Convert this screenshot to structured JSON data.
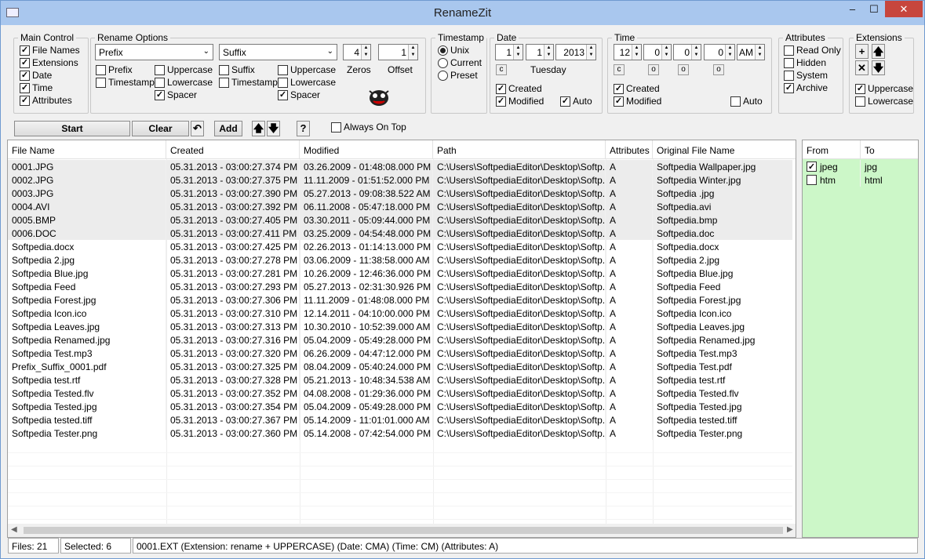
{
  "window": {
    "title": "RenameZit",
    "min": "–",
    "max": "☐",
    "close": "✕"
  },
  "main_control": {
    "legend": "Main Control",
    "items": [
      {
        "label": "File Names",
        "checked": true
      },
      {
        "label": "Extensions",
        "checked": true
      },
      {
        "label": "Date",
        "checked": true
      },
      {
        "label": "Time",
        "checked": true
      },
      {
        "label": "Attributes",
        "checked": true
      }
    ]
  },
  "rename_options": {
    "legend": "Rename Options",
    "prefix_value": "Prefix",
    "suffix_value": "Suffix",
    "zeros_value": "4",
    "offset_value": "1",
    "zeros_label": "Zeros",
    "offset_label": "Offset",
    "left_checks": [
      {
        "label": "Prefix",
        "checked": false
      },
      {
        "label": "Timestamp",
        "checked": false
      }
    ],
    "left_case": [
      {
        "label": "Uppercase",
        "checked": false
      },
      {
        "label": "Lowercase",
        "checked": false
      },
      {
        "label": "Spacer",
        "checked": true
      }
    ],
    "right_checks": [
      {
        "label": "Suffix",
        "checked": false
      },
      {
        "label": "Timestamp",
        "checked": false
      }
    ],
    "right_case": [
      {
        "label": "Uppercase",
        "checked": false
      },
      {
        "label": "Lowercase",
        "checked": false
      },
      {
        "label": "Spacer",
        "checked": true
      }
    ]
  },
  "timestamp": {
    "legend": "Timestamp",
    "options": [
      {
        "label": "Unix",
        "selected": true
      },
      {
        "label": "Current",
        "selected": false
      },
      {
        "label": "Preset",
        "selected": false
      }
    ]
  },
  "date": {
    "legend": "Date",
    "month": "1",
    "day": "1",
    "year": "2013",
    "c_label": "c",
    "weekday": "Tuesday",
    "created": {
      "label": "Created",
      "checked": true
    },
    "modified": {
      "label": "Modified",
      "checked": true
    },
    "auto": {
      "label": "Auto",
      "checked": true
    }
  },
  "time": {
    "legend": "Time",
    "hour": "12",
    "minute": "0",
    "second": "0",
    "ms": "0",
    "ampm": "AM",
    "c_label": "c",
    "o_label": "o",
    "created": {
      "label": "Created",
      "checked": true
    },
    "modified": {
      "label": "Modified",
      "checked": true
    },
    "auto": {
      "label": "Auto",
      "checked": false
    }
  },
  "attributes": {
    "legend": "Attributes",
    "items": [
      {
        "label": "Read Only",
        "checked": false
      },
      {
        "label": "Hidden",
        "checked": false
      },
      {
        "label": "System",
        "checked": false
      },
      {
        "label": "Archive",
        "checked": true
      }
    ]
  },
  "extensions": {
    "legend": "Extensions",
    "add": "+",
    "up": "🡅",
    "remove": "✕",
    "down": "🡇",
    "uppercase": {
      "label": "Uppercase",
      "checked": true
    },
    "lowercase": {
      "label": "Lowercase",
      "checked": false
    }
  },
  "toolbar": {
    "start": "Start",
    "clear": "Clear",
    "undo": "↶",
    "add": "Add",
    "up": "🡅",
    "down": "🡇",
    "help": "?",
    "always_on_top": {
      "label": "Always On Top",
      "checked": false
    }
  },
  "file_table": {
    "columns": [
      "File Name",
      "Created",
      "Modified",
      "Path",
      "Attributes",
      "Original File Name"
    ],
    "rows": [
      [
        "0001.JPG",
        "05.31.2013 - 03:00:27.374 PM",
        "03.26.2009 - 01:48:08.000 PM",
        "C:\\Users\\SoftpediaEditor\\Desktop\\Softp...",
        "A",
        "Softpedia Wallpaper.jpg"
      ],
      [
        "0002.JPG",
        "05.31.2013 - 03:00:27.375 PM",
        "11.11.2009 - 01:51:52.000 PM",
        "C:\\Users\\SoftpediaEditor\\Desktop\\Softp...",
        "A",
        "Softpedia Winter.jpg"
      ],
      [
        "0003.JPG",
        "05.31.2013 - 03:00:27.390 PM",
        "05.27.2013 - 09:08:38.522 AM",
        "C:\\Users\\SoftpediaEditor\\Desktop\\Softp...",
        "A",
        "Softpedia .jpg"
      ],
      [
        "0004.AVI",
        "05.31.2013 - 03:00:27.392 PM",
        "06.11.2008 - 05:47:18.000 PM",
        "C:\\Users\\SoftpediaEditor\\Desktop\\Softp...",
        "A",
        "Softpedia.avi"
      ],
      [
        "0005.BMP",
        "05.31.2013 - 03:00:27.405 PM",
        "03.30.2011 - 05:09:44.000 PM",
        "C:\\Users\\SoftpediaEditor\\Desktop\\Softp...",
        "A",
        "Softpedia.bmp"
      ],
      [
        "0006.DOC",
        "05.31.2013 - 03:00:27.411 PM",
        "03.25.2009 - 04:54:48.000 PM",
        "C:\\Users\\SoftpediaEditor\\Desktop\\Softp...",
        "A",
        "Softpedia.doc"
      ],
      [
        "Softpedia.docx",
        "05.31.2013 - 03:00:27.425 PM",
        "02.26.2013 - 01:14:13.000 PM",
        "C:\\Users\\SoftpediaEditor\\Desktop\\Softp...",
        "A",
        "Softpedia.docx"
      ],
      [
        "Softpedia 2.jpg",
        "05.31.2013 - 03:00:27.278 PM",
        "03.06.2009 - 11:38:58.000 AM",
        "C:\\Users\\SoftpediaEditor\\Desktop\\Softp...",
        "A",
        "Softpedia 2.jpg"
      ],
      [
        "Softpedia Blue.jpg",
        "05.31.2013 - 03:00:27.281 PM",
        "10.26.2009 - 12:46:36.000 PM",
        "C:\\Users\\SoftpediaEditor\\Desktop\\Softp...",
        "A",
        "Softpedia Blue.jpg"
      ],
      [
        "Softpedia Feed",
        "05.31.2013 - 03:00:27.293 PM",
        "05.27.2013 - 02:31:30.926 PM",
        "C:\\Users\\SoftpediaEditor\\Desktop\\Softp...",
        "A",
        "Softpedia Feed"
      ],
      [
        "Softpedia Forest.jpg",
        "05.31.2013 - 03:00:27.306 PM",
        "11.11.2009 - 01:48:08.000 PM",
        "C:\\Users\\SoftpediaEditor\\Desktop\\Softp...",
        "A",
        "Softpedia Forest.jpg"
      ],
      [
        "Softpedia Icon.ico",
        "05.31.2013 - 03:00:27.310 PM",
        "12.14.2011 - 04:10:00.000 PM",
        "C:\\Users\\SoftpediaEditor\\Desktop\\Softp...",
        "A",
        "Softpedia Icon.ico"
      ],
      [
        "Softpedia Leaves.jpg",
        "05.31.2013 - 03:00:27.313 PM",
        "10.30.2010 - 10:52:39.000 AM",
        "C:\\Users\\SoftpediaEditor\\Desktop\\Softp...",
        "A",
        "Softpedia Leaves.jpg"
      ],
      [
        "Softpedia Renamed.jpg",
        "05.31.2013 - 03:00:27.316 PM",
        "05.04.2009 - 05:49:28.000 PM",
        "C:\\Users\\SoftpediaEditor\\Desktop\\Softp...",
        "A",
        "Softpedia Renamed.jpg"
      ],
      [
        "Softpedia Test.mp3",
        "05.31.2013 - 03:00:27.320 PM",
        "06.26.2009 - 04:47:12.000 PM",
        "C:\\Users\\SoftpediaEditor\\Desktop\\Softp...",
        "A",
        "Softpedia Test.mp3"
      ],
      [
        "Prefix_Suffix_0001.pdf",
        "05.31.2013 - 03:00:27.325 PM",
        "08.04.2009 - 05:40:24.000 PM",
        "C:\\Users\\SoftpediaEditor\\Desktop\\Softp...",
        "A",
        "Softpedia Test.pdf"
      ],
      [
        "Softpedia test.rtf",
        "05.31.2013 - 03:00:27.328 PM",
        "05.21.2013 - 10:48:34.538 AM",
        "C:\\Users\\SoftpediaEditor\\Desktop\\Softp...",
        "A",
        "Softpedia test.rtf"
      ],
      [
        "Softpedia Tested.flv",
        "05.31.2013 - 03:00:27.352 PM",
        "04.08.2008 - 01:29:36.000 PM",
        "C:\\Users\\SoftpediaEditor\\Desktop\\Softp...",
        "A",
        "Softpedia Tested.flv"
      ],
      [
        "Softpedia Tested.jpg",
        "05.31.2013 - 03:00:27.354 PM",
        "05.04.2009 - 05:49:28.000 PM",
        "C:\\Users\\SoftpediaEditor\\Desktop\\Softp...",
        "A",
        "Softpedia Tested.jpg"
      ],
      [
        "Softpedia tested.tiff",
        "05.31.2013 - 03:00:27.367 PM",
        "05.14.2009 - 11:01:01.000 AM",
        "C:\\Users\\SoftpediaEditor\\Desktop\\Softp...",
        "A",
        "Softpedia tested.tiff"
      ],
      [
        "Softpedia Tester.png",
        "05.31.2013 - 03:00:27.360 PM",
        "05.14.2008 - 07:42:54.000 PM",
        "C:\\Users\\SoftpediaEditor\\Desktop\\Softp...",
        "A",
        "Softpedia Tester.png"
      ]
    ],
    "selected_rows": 6,
    "scroll_left": "◀",
    "scroll_right": "▶"
  },
  "ext_table": {
    "columns": [
      "From",
      "To"
    ],
    "rows": [
      {
        "from": "jpeg",
        "to": "jpg",
        "checked": true
      },
      {
        "from": "htm",
        "to": "html",
        "checked": false
      }
    ],
    "bg": "#ccf7c8"
  },
  "status": {
    "files": "Files: 21",
    "selected": "Selected: 6",
    "info": "0001.EXT   (Extension: rename + UPPERCASE)   (Date: CMA)   (Time: CM)   (Attributes: A)"
  }
}
